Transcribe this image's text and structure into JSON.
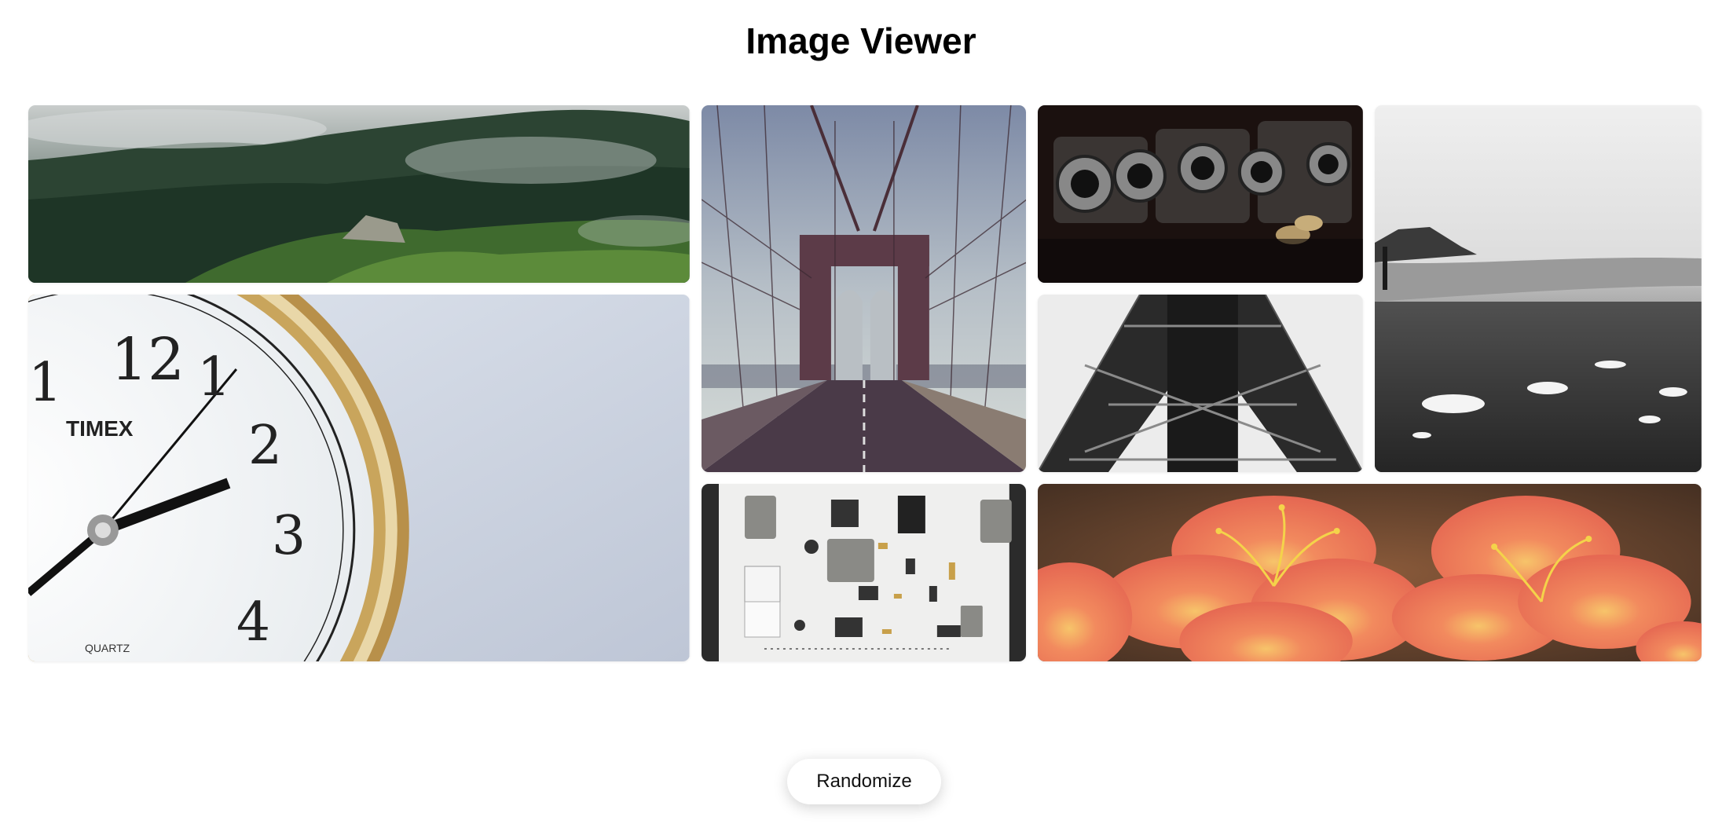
{
  "page": {
    "title": "Image Viewer"
  },
  "images": [
    {
      "id": "forest",
      "subject": "misty forest hillside"
    },
    {
      "id": "clock",
      "subject": "pocket watch close-up",
      "brand_text": "TIMEX",
      "dial_text": "QUARTZ",
      "numerals": [
        "12",
        "1",
        "2",
        "3",
        "4",
        "1"
      ]
    },
    {
      "id": "bridge",
      "subject": "suspension bridge walkway"
    },
    {
      "id": "camera",
      "subject": "vintage cameras"
    },
    {
      "id": "tower",
      "subject": "steel lattice tower"
    },
    {
      "id": "beach",
      "subject": "black and white beach"
    },
    {
      "id": "parts",
      "subject": "disassembled device parts"
    },
    {
      "id": "flowers",
      "subject": "orange lily flowers"
    }
  ],
  "controls": {
    "randomize_label": "Randomize"
  },
  "colors": {
    "background": "#ffffff",
    "title": "#000000",
    "button_bg": "#ffffff",
    "button_text": "#111111"
  }
}
